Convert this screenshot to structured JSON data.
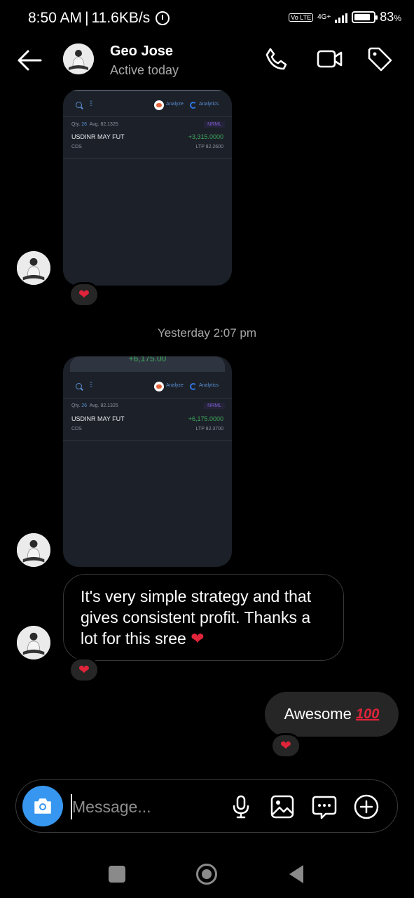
{
  "status_bar": {
    "time": "8:50 AM",
    "separator": "|",
    "speed": "11.6KB/s",
    "volte": "Vo LTE",
    "network": "4G+",
    "battery_percent": "83",
    "battery_unit": "%",
    "battery_level": 0.83
  },
  "header": {
    "name": "Geo Jose",
    "status": "Active today"
  },
  "messages": {
    "shot1": {
      "analyze": "Analyze",
      "analytics": "Analytics",
      "qty_label": "Qty.",
      "qty": "26",
      "avg_label": "Avg.",
      "avg": "82.1325",
      "product": "NRML",
      "symbol": "USDINR MAY FUT",
      "pnl": "+3,315.0000",
      "exchange": "CDS",
      "ltp": "LTP 82.2600"
    },
    "timestamp": "Yesterday 2:07 pm",
    "shot2": {
      "top_pnl": "+6,175.00",
      "analyze": "Analyze",
      "analytics": "Analytics",
      "qty_label": "Qty.",
      "qty": "26",
      "avg_label": "Avg.",
      "avg": "82.1325",
      "product": "NRML",
      "symbol": "USDINR MAY FUT",
      "pnl": "+6,175.0000",
      "exchange": "CDS",
      "ltp": "LTP 82.3700"
    },
    "incoming_text": "It's very simple strategy and that gives consistent profit. Thanks a lot for this sree",
    "outgoing_text": "Awesome",
    "heart_emoji": "❤",
    "hundred_emoji": "100"
  },
  "composer": {
    "placeholder": "Message..."
  },
  "colors": {
    "accent": "#3797f0",
    "heart": "#e0243a",
    "profit": "#3fa85d"
  }
}
